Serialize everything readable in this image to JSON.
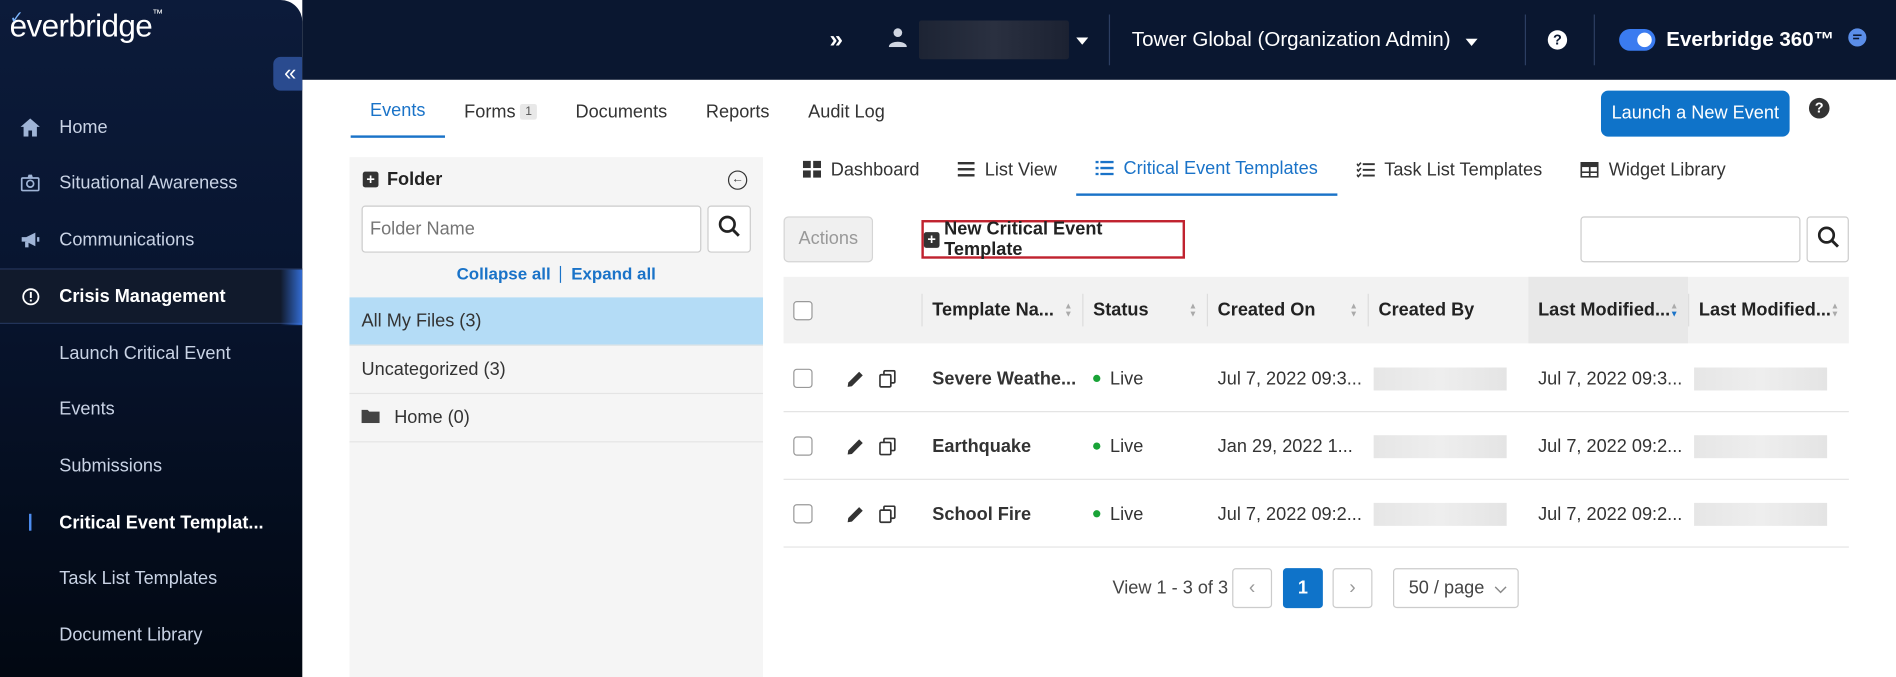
{
  "brand": {
    "logo_text": "everbridge",
    "logo_tm": "™",
    "collapse_glyph": "«"
  },
  "sidebar": {
    "items": [
      {
        "label": "Home",
        "icon": "home-icon"
      },
      {
        "label": "Situational Awareness",
        "icon": "globe-icon"
      },
      {
        "label": "Communications",
        "icon": "megaphone-icon"
      },
      {
        "label": "Crisis Management",
        "icon": "alert-circle-icon"
      }
    ],
    "subitems": [
      {
        "label": "Launch Critical Event"
      },
      {
        "label": "Events"
      },
      {
        "label": "Submissions"
      },
      {
        "label": "Critical Event Templat..."
      },
      {
        "label": "Task List Templates"
      },
      {
        "label": "Document Library"
      }
    ]
  },
  "topbar": {
    "expand_glyph": "»",
    "org": "Tower Global (Organization Admin)",
    "help_glyph": "?",
    "product": "Everbridge 360™"
  },
  "main_tabs": [
    {
      "label": "Events"
    },
    {
      "label": "Forms",
      "badge": "1"
    },
    {
      "label": "Documents"
    },
    {
      "label": "Reports"
    },
    {
      "label": "Audit Log"
    }
  ],
  "launch_button": "Launch a New Event",
  "help_glyph": "?",
  "folder": {
    "title": "Folder",
    "plus_glyph": "+",
    "collapse_glyph": "←",
    "placeholder": "Folder Name",
    "collapse_all": "Collapse all",
    "expand_all": "Expand all",
    "rows": [
      "All My Files (3)",
      "Uncategorized (3)",
      "Home (0)"
    ]
  },
  "subtabs": [
    {
      "label": "Dashboard"
    },
    {
      "label": "List View"
    },
    {
      "label": "Critical Event Templates"
    },
    {
      "label": "Task List Templates"
    },
    {
      "label": "Widget Library"
    }
  ],
  "toolbar": {
    "actions": "Actions",
    "new_template": "New Critical Event Template",
    "new_template_glyph": "+"
  },
  "table": {
    "headers": [
      "Template Na...",
      "Status",
      "Created On",
      "Created By",
      "Last Modified...",
      "Last Modified..."
    ],
    "sort_up": "▲",
    "sort_down": "▼",
    "rows": [
      {
        "name": "Severe Weathe...",
        "status": "Live",
        "created_on": "Jul 7, 2022 09:3...",
        "modified": "Jul 7, 2022 09:3..."
      },
      {
        "name": "Earthquake",
        "status": "Live",
        "created_on": "Jan 29, 2022 1...",
        "modified": "Jul 7, 2022 09:2..."
      },
      {
        "name": "School Fire",
        "status": "Live",
        "created_on": "Jul 7, 2022 09:2...",
        "modified": "Jul 7, 2022 09:2..."
      }
    ]
  },
  "pagination": {
    "summary": "View 1 - 3 of 3",
    "prev": "‹",
    "current": "1",
    "next": "›",
    "per_page": "50 / page"
  },
  "colors": {
    "accent": "#1a73c8",
    "launch": "#0f73c9",
    "live": "#19a337",
    "highlight": "#c0222f",
    "selected_row": "#b4dcf6"
  }
}
